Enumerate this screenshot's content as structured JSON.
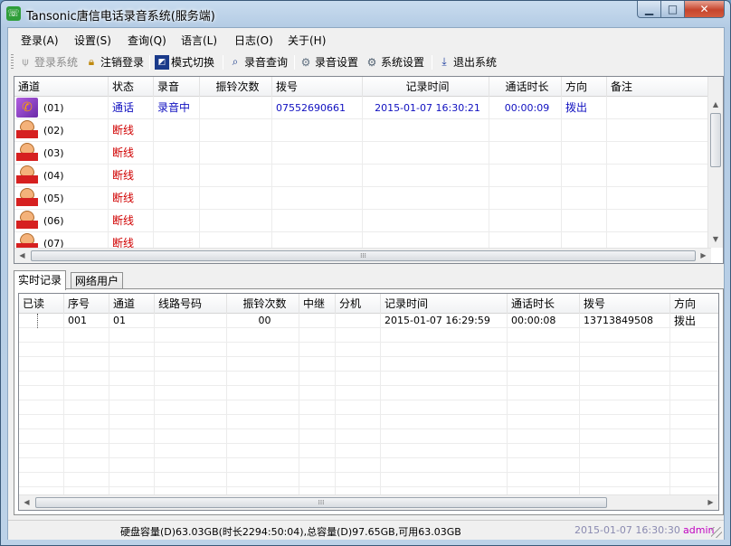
{
  "window": {
    "title": "Tansonic唐信电话录音系统(服务端)"
  },
  "menu": [
    "登录(A)",
    "设置(S)",
    "查询(Q)",
    "语言(L)",
    "日志(O)",
    "关于(H)"
  ],
  "toolbar": {
    "login": "登录系统",
    "logout": "注销登录",
    "mode": "模式切换",
    "query": "录音查询",
    "rec_settings": "录音设置",
    "sys_settings": "系统设置",
    "exit": "退出系统"
  },
  "channels": {
    "columns": [
      "通道",
      "状态",
      "录音",
      "振铃次数",
      "拨号",
      "记录时间",
      "通话时长",
      "方向",
      "备注"
    ],
    "rows": [
      {
        "ch": "(01)",
        "status": "通话",
        "rec": "录音中",
        "ring": "",
        "dial": "07552690661",
        "time": "2015-01-07 16:30:21",
        "dur": "00:00:09",
        "dir": "拨出",
        "note": ""
      },
      {
        "ch": "(02)",
        "status": "断线",
        "rec": "",
        "ring": "",
        "dial": "",
        "time": "",
        "dur": "",
        "dir": "",
        "note": ""
      },
      {
        "ch": "(03)",
        "status": "断线",
        "rec": "",
        "ring": "",
        "dial": "",
        "time": "",
        "dur": "",
        "dir": "",
        "note": ""
      },
      {
        "ch": "(04)",
        "status": "断线",
        "rec": "",
        "ring": "",
        "dial": "",
        "time": "",
        "dur": "",
        "dir": "",
        "note": ""
      },
      {
        "ch": "(05)",
        "status": "断线",
        "rec": "",
        "ring": "",
        "dial": "",
        "time": "",
        "dur": "",
        "dir": "",
        "note": ""
      },
      {
        "ch": "(06)",
        "status": "断线",
        "rec": "",
        "ring": "",
        "dial": "",
        "time": "",
        "dur": "",
        "dir": "",
        "note": ""
      },
      {
        "ch": "(07)",
        "status": "断线",
        "rec": "",
        "ring": "",
        "dial": "",
        "time": "",
        "dur": "",
        "dir": "",
        "note": ""
      }
    ]
  },
  "tabs": [
    "实时记录",
    "网络用户"
  ],
  "records": {
    "columns": [
      "已读",
      "序号",
      "通道",
      "线路号码",
      "振铃次数",
      "中继",
      "分机",
      "记录时间",
      "通话时长",
      "拨号",
      "方向"
    ],
    "rows": [
      {
        "read": "",
        "seq": "001",
        "ch": "01",
        "line": "",
        "ring": "00",
        "trunk": "",
        "ext": "",
        "time": "2015-01-07 16:29:59",
        "dur": "00:00:08",
        "dial": "13713849508",
        "dir": "拨出"
      }
    ]
  },
  "status": {
    "disk": "硬盘容量(D)63.03GB(时长2294:50:04),总容量(D)97.65GB,可用63.03GB",
    "datetime": "2015-01-07 16:30:30",
    "user": "admin"
  },
  "colors": {
    "status_off": "#d00000",
    "status_on": "#1010c0",
    "user": "#c000c0",
    "datetime": "#8a8ab0"
  },
  "icons": {
    "login": "antenna-icon",
    "logout": "lock-icon",
    "mode": "mode-switch-icon",
    "query": "magnifier-icon",
    "rec_settings": "gear-icon",
    "sys_settings": "gears-icon",
    "exit": "exit-icon"
  }
}
